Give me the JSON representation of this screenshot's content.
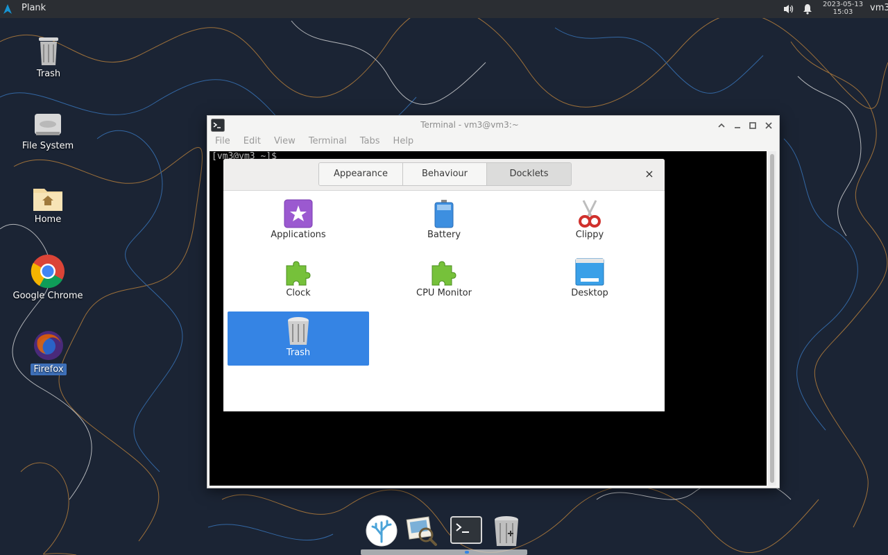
{
  "panel": {
    "app_name": "Plank",
    "date": "2023-05-13",
    "time": "15:03",
    "user": "vm3"
  },
  "desktop": {
    "icons": [
      {
        "label": "Trash",
        "icon": "trash-icon"
      },
      {
        "label": "File System",
        "icon": "drive-icon"
      },
      {
        "label": "Home",
        "icon": "home-folder-icon"
      },
      {
        "label": "Google Chrome",
        "icon": "chrome-icon"
      },
      {
        "label": "Firefox",
        "icon": "firefox-icon",
        "selected": true
      }
    ]
  },
  "terminal": {
    "title": "Terminal - vm3@vm3:~",
    "menu": [
      "File",
      "Edit",
      "View",
      "Terminal",
      "Tabs",
      "Help"
    ],
    "prompt": "[vm3@vm3 ~]$ "
  },
  "preferences": {
    "tabs": [
      "Appearance",
      "Behaviour",
      "Docklets"
    ],
    "active_tab": "Docklets",
    "close_label": "×",
    "docklets": [
      {
        "label": "Applications",
        "icon": "applications-icon"
      },
      {
        "label": "Battery",
        "icon": "battery-icon"
      },
      {
        "label": "Clippy",
        "icon": "scissors-icon"
      },
      {
        "label": "Clock",
        "icon": "puzzle-icon"
      },
      {
        "label": "CPU Monitor",
        "icon": "puzzle-icon"
      },
      {
        "label": "Desktop",
        "icon": "desktop-icon"
      },
      {
        "label": "Trash",
        "icon": "trash-icon",
        "selected": true
      }
    ]
  },
  "dock": {
    "items": [
      "coral-icon",
      "image-viewer-icon",
      "terminal-icon",
      "trash-icon"
    ]
  },
  "colors": {
    "panel_bg": "#2b2e33",
    "wallpaper_bg": "#1b2434",
    "selection": "#3584e4"
  }
}
